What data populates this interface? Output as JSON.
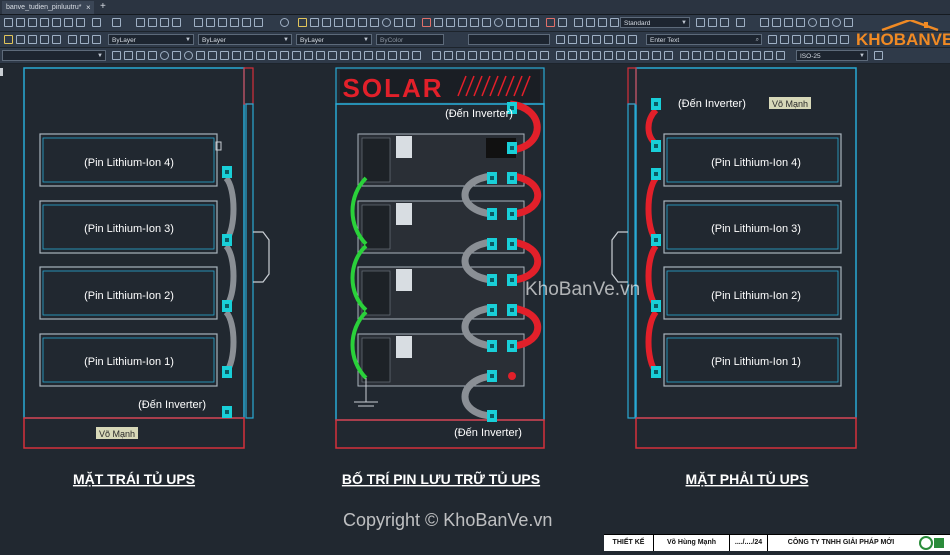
{
  "app": {
    "tab_title": "banve_tudien_pinluutru*",
    "tab_close": "×",
    "tab_add": "+"
  },
  "toolbar": {
    "text_style": "Standard",
    "layer": "ByLayer",
    "linetype": "ByLayer",
    "lineweight": "ByLayer",
    "plot_style": "ByColor",
    "text_search_placeholder": "Enter Text",
    "dim_style": "ISO-25"
  },
  "logo": {
    "text": "KHOBANVE"
  },
  "drawing": {
    "left_view": {
      "title": "MẶT TRÁI TỦ UPS",
      "batteries": [
        "(Pin Lithium-Ion 4)",
        "(Pin Lithium-Ion 3)",
        "(Pin Lithium-Ion 2)",
        "(Pin Lithium-Ion 1)"
      ],
      "inverter_label": "(Đến Inverter)",
      "author_tag": "Võ Mạnh"
    },
    "center_view": {
      "title": "BỐ TRÍ PIN LƯU TRỮ TỦ UPS",
      "brand": "SOLAR",
      "inverter_top": "(Đến Inverter)",
      "inverter_bottom": "(Đến Inverter)"
    },
    "right_view": {
      "title": "MẶT PHẢI TỦ UPS",
      "batteries": [
        "(Pin Lithium-Ion 4)",
        "(Pin Lithium-Ion 3)",
        "(Pin Lithium-Ion 2)",
        "(Pin Lithium-Ion 1)"
      ],
      "inverter_label": "(Đến Inverter)",
      "author_tag": "Võ Mạnh"
    }
  },
  "watermark": "KhoBanVe.vn",
  "copyright": "Copyright © KhoBanVe.vn",
  "title_block": {
    "role": "THIẾT KẾ",
    "designer": "Võ Hùng Mạnh",
    "date": "..../..../24",
    "company": "CÔNG TY TNHH GIẢI PHÁP MỚI"
  },
  "colors": {
    "cabinet_cyan": "#29a9d4",
    "cabinet_red": "#d5303a",
    "cable_red": "#e2202a",
    "cable_green": "#2ad13a",
    "cable_gray": "#8a8f95",
    "terminal_cyan": "#19cfd8"
  }
}
